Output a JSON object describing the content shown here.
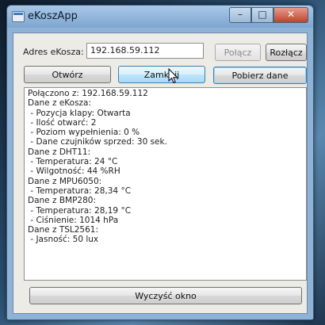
{
  "window": {
    "title": "eKoszApp",
    "controls": {
      "minimize": "–",
      "maximize": "□",
      "close": "✕"
    }
  },
  "connection": {
    "address_label": "Adres eKosza:",
    "address_value": "192.168.59.112",
    "connect_label": "Połącz",
    "disconnect_label": "Rozłącz"
  },
  "actions": {
    "open_label": "Otwórz",
    "close_label": "Zamknij",
    "fetch_label": "Pobierz dane"
  },
  "output_lines": [
    "Połączono z: 192.168.59.112",
    "Dane z eKosza:",
    " - Pozycja klapy: Otwarta",
    " - Ilość otwarć: 2",
    " - Poziom wypełnienia: 0 %",
    " - Dane czujników sprzed: 30 sek.",
    "Dane z DHT11:",
    " - Temperatura: 24 °C",
    " - Wilgotność: 44 %RH",
    "Dane z MPU6050:",
    " - Temperatura: 28,34 °C",
    "Dane z BMP280:",
    " - Temperatura: 28,19 °C",
    " - Ciśnienie: 1014 hPa",
    "Dane z TSL2561:",
    " - Jasność: 50 lux"
  ],
  "footer": {
    "clear_label": "Wyczyść okno"
  }
}
